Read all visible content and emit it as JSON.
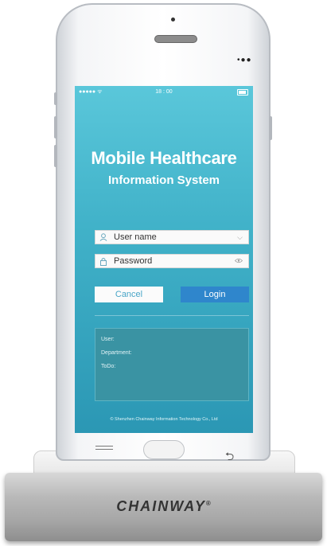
{
  "status_bar": {
    "signal": "●●●●● ᯤ",
    "time": "18 : 00"
  },
  "login": {
    "title": "Mobile Healthcare",
    "subtitle": "Information System",
    "username_placeholder": "User name",
    "password_placeholder": "Password",
    "cancel_label": "Cancel",
    "login_label": "Login"
  },
  "info_panel": {
    "user_label": "User:",
    "department_label": "Department:",
    "todo_label": "ToDo:"
  },
  "footer": "© Shenzhen Chainway Information Technology Co., Ltd",
  "dock": {
    "brand": "CHAINWAY",
    "reg": "®"
  },
  "colors": {
    "screen_top": "#5ac7da",
    "screen_bottom": "#2b97b4",
    "login_button": "#2f86cc",
    "panel": "#3a93a3"
  }
}
